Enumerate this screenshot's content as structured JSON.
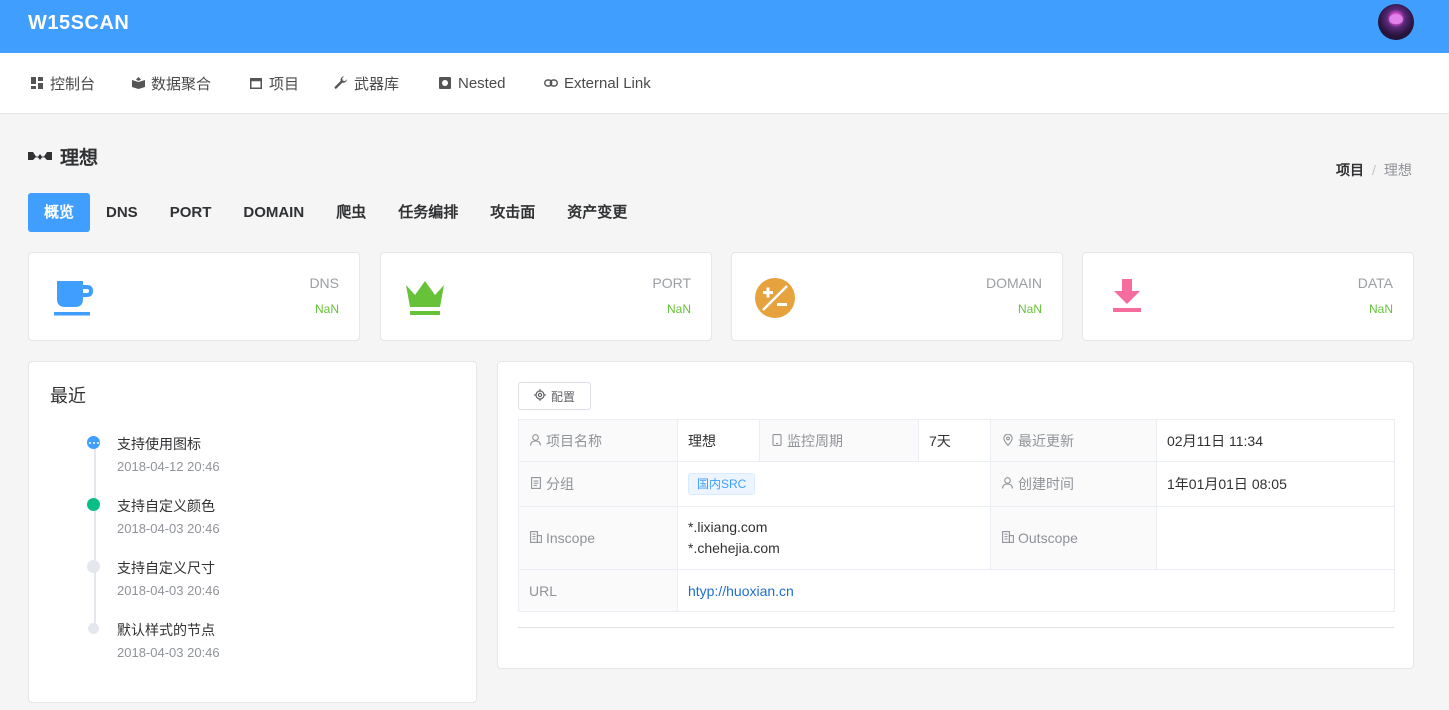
{
  "header": {
    "brand": "W15SCAN"
  },
  "nav": {
    "items": [
      {
        "label": "控制台",
        "icon": "dashboard-icon"
      },
      {
        "label": "数据聚合",
        "icon": "data-icon"
      },
      {
        "label": "项目",
        "icon": "window-icon"
      },
      {
        "label": "武器库",
        "icon": "wrench-icon"
      },
      {
        "label": "Nested",
        "icon": "square-icon"
      },
      {
        "label": "External Link",
        "icon": "link-icon"
      }
    ]
  },
  "page": {
    "title": "理想"
  },
  "breadcrumb": {
    "parent": "项目",
    "separator": "/",
    "current": "理想"
  },
  "tabs": [
    "概览",
    "DNS",
    "PORT",
    "DOMAIN",
    "爬虫",
    "任务编排",
    "攻击面",
    "资产变更"
  ],
  "stats": [
    {
      "label": "DNS",
      "value": "NaN",
      "icon": "coffee-cup-icon",
      "color": "#409eff"
    },
    {
      "label": "PORT",
      "value": "NaN",
      "icon": "crown-icon",
      "color": "#67c23a"
    },
    {
      "label": "DOMAIN",
      "value": "NaN",
      "icon": "plus-minus-icon",
      "color": "#e6a23c"
    },
    {
      "label": "DATA",
      "value": "NaN",
      "icon": "download-icon",
      "color": "#f56c9d"
    }
  ],
  "recent": {
    "title": "最近",
    "items": [
      {
        "content": "支持使用图标",
        "time": "2018-04-12 20:46"
      },
      {
        "content": "支持自定义颜色",
        "time": "2018-04-03 20:46"
      },
      {
        "content": "支持自定义尺寸",
        "time": "2018-04-03 20:46"
      },
      {
        "content": "默认样式的节点",
        "time": "2018-04-03 20:46"
      }
    ]
  },
  "detail": {
    "config_label": "配置",
    "project_name_label": "项目名称",
    "project_name": "理想",
    "monitor_label": "监控周期",
    "monitor_value": "7天",
    "updated_label": "最近更新",
    "updated_value": "02月11日 11:34",
    "group_label": "分组",
    "group_tag": "国内SRC",
    "created_label": "创建时间",
    "created_value": "1年01月01日 08:05",
    "inscope_label": "Inscope",
    "inscope": [
      "*.lixiang.com",
      "*.chehejia.com"
    ],
    "outscope_label": "Outscope",
    "url_label": "URL",
    "url_value": "htyp://huoxian.cn"
  }
}
